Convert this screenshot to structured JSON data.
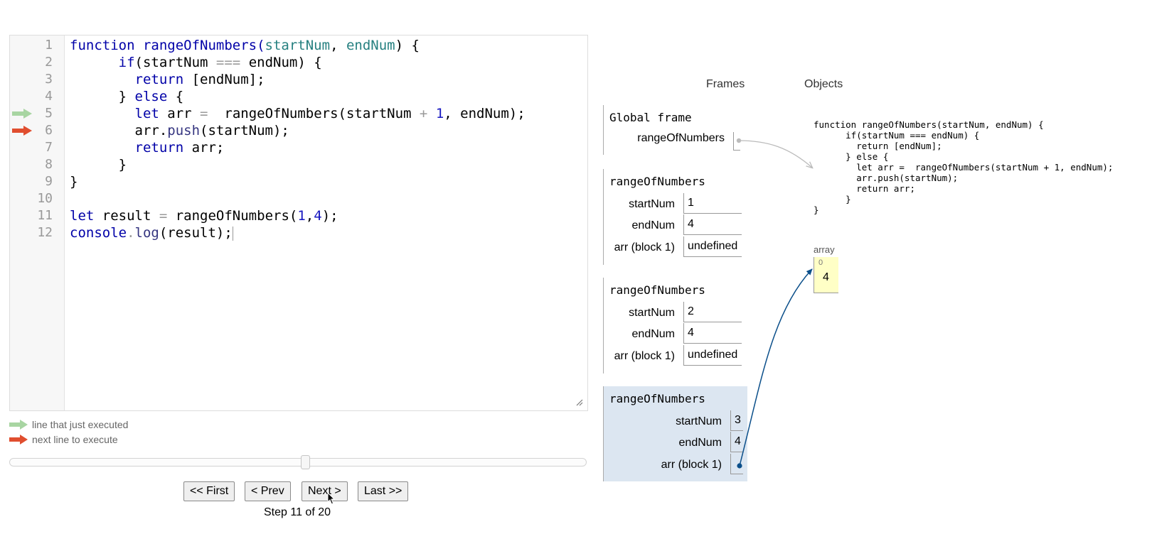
{
  "code": {
    "lines": [
      {
        "n": "1",
        "tokens": [
          {
            "t": "function",
            "c": "kw"
          },
          {
            "t": " rangeOfNumbers(",
            "c": "kw"
          },
          {
            "t": "startNum",
            "c": "par"
          },
          {
            "t": ", ",
            "c": ""
          },
          {
            "t": "endNum",
            "c": "par"
          },
          {
            "t": ") {",
            "c": ""
          }
        ]
      },
      {
        "n": "2",
        "tokens": [
          {
            "t": "      ",
            "c": ""
          },
          {
            "t": "if",
            "c": "kw"
          },
          {
            "t": "(startNum ",
            "c": ""
          },
          {
            "t": "===",
            "c": "op"
          },
          {
            "t": " endNum) {",
            "c": ""
          }
        ]
      },
      {
        "n": "3",
        "tokens": [
          {
            "t": "        ",
            "c": ""
          },
          {
            "t": "return",
            "c": "kw"
          },
          {
            "t": " [endNum];",
            "c": ""
          }
        ]
      },
      {
        "n": "4",
        "tokens": [
          {
            "t": "      } ",
            "c": ""
          },
          {
            "t": "else",
            "c": "kw"
          },
          {
            "t": " {",
            "c": ""
          }
        ]
      },
      {
        "n": "5",
        "tokens": [
          {
            "t": "        ",
            "c": ""
          },
          {
            "t": "let",
            "c": "kw"
          },
          {
            "t": " arr ",
            "c": ""
          },
          {
            "t": "=",
            "c": "op"
          },
          {
            "t": "  rangeOfNumbers(startNum ",
            "c": ""
          },
          {
            "t": "+",
            "c": "op"
          },
          {
            "t": " ",
            "c": ""
          },
          {
            "t": "1",
            "c": "num"
          },
          {
            "t": ", endNum);",
            "c": ""
          }
        ]
      },
      {
        "n": "6",
        "tokens": [
          {
            "t": "        arr.",
            "c": ""
          },
          {
            "t": "push",
            "c": "prop"
          },
          {
            "t": "(startNum);",
            "c": ""
          }
        ]
      },
      {
        "n": "7",
        "tokens": [
          {
            "t": "        ",
            "c": ""
          },
          {
            "t": "return",
            "c": "kw"
          },
          {
            "t": " arr;",
            "c": ""
          }
        ]
      },
      {
        "n": "8",
        "tokens": [
          {
            "t": "      }",
            "c": ""
          }
        ]
      },
      {
        "n": "9",
        "tokens": [
          {
            "t": "}",
            "c": ""
          }
        ]
      },
      {
        "n": "10",
        "tokens": []
      },
      {
        "n": "11",
        "tokens": [
          {
            "t": "let",
            "c": "kw"
          },
          {
            "t": " result ",
            "c": ""
          },
          {
            "t": "=",
            "c": "op"
          },
          {
            "t": " rangeOfNumbers(",
            "c": ""
          },
          {
            "t": "1",
            "c": "num"
          },
          {
            "t": ",",
            "c": ""
          },
          {
            "t": "4",
            "c": "num"
          },
          {
            "t": ");",
            "c": ""
          }
        ]
      },
      {
        "n": "12",
        "tokens": [
          {
            "t": "console",
            "c": "kw"
          },
          {
            "t": ".",
            "c": "op"
          },
          {
            "t": "log",
            "c": "prop"
          },
          {
            "t": "(result);",
            "c": ""
          }
        ]
      }
    ],
    "executed_line": 5,
    "next_line": 6
  },
  "legend": {
    "executed": "line that just executed",
    "next": "next line to execute"
  },
  "colors": {
    "executed_arrow": "#a8d5a2",
    "next_arrow": "#e04e2f",
    "active_frame": "#dce6f1",
    "heap_object": "#ffffc6",
    "pointer": "#0b4f8a"
  },
  "nav": {
    "first": "<< First",
    "prev": "< Prev",
    "next": "Next >",
    "last": "Last >>",
    "step_text": "Step 11 of 20",
    "step_current": 11,
    "step_total": 20
  },
  "viz": {
    "frames_heading": "Frames",
    "objects_heading": "Objects",
    "global_frame": {
      "title": "Global frame",
      "vars": [
        {
          "name": "rangeOfNumbers"
        }
      ]
    },
    "frames": [
      {
        "title": "rangeOfNumbers",
        "vars": [
          {
            "name": "startNum",
            "value": "1"
          },
          {
            "name": "endNum",
            "value": "4"
          },
          {
            "name": "arr (block 1)",
            "value": "undefined"
          }
        ]
      },
      {
        "title": "rangeOfNumbers",
        "vars": [
          {
            "name": "startNum",
            "value": "2"
          },
          {
            "name": "endNum",
            "value": "4"
          },
          {
            "name": "arr (block 1)",
            "value": "undefined"
          }
        ]
      },
      {
        "title": "rangeOfNumbers",
        "vars": [
          {
            "name": "startNum",
            "value": "3"
          },
          {
            "name": "endNum",
            "value": "4"
          },
          {
            "name": "arr (block 1)"
          }
        ]
      }
    ],
    "function_object": "function rangeOfNumbers(startNum, endNum) {\n      if(startNum === endNum) {\n        return [endNum];\n      } else {\n        let arr =  rangeOfNumbers(startNum + 1, endNum);\n        arr.push(startNum);\n        return arr;\n      }\n}",
    "array": {
      "label": "array",
      "index": "0",
      "value": "4"
    }
  }
}
